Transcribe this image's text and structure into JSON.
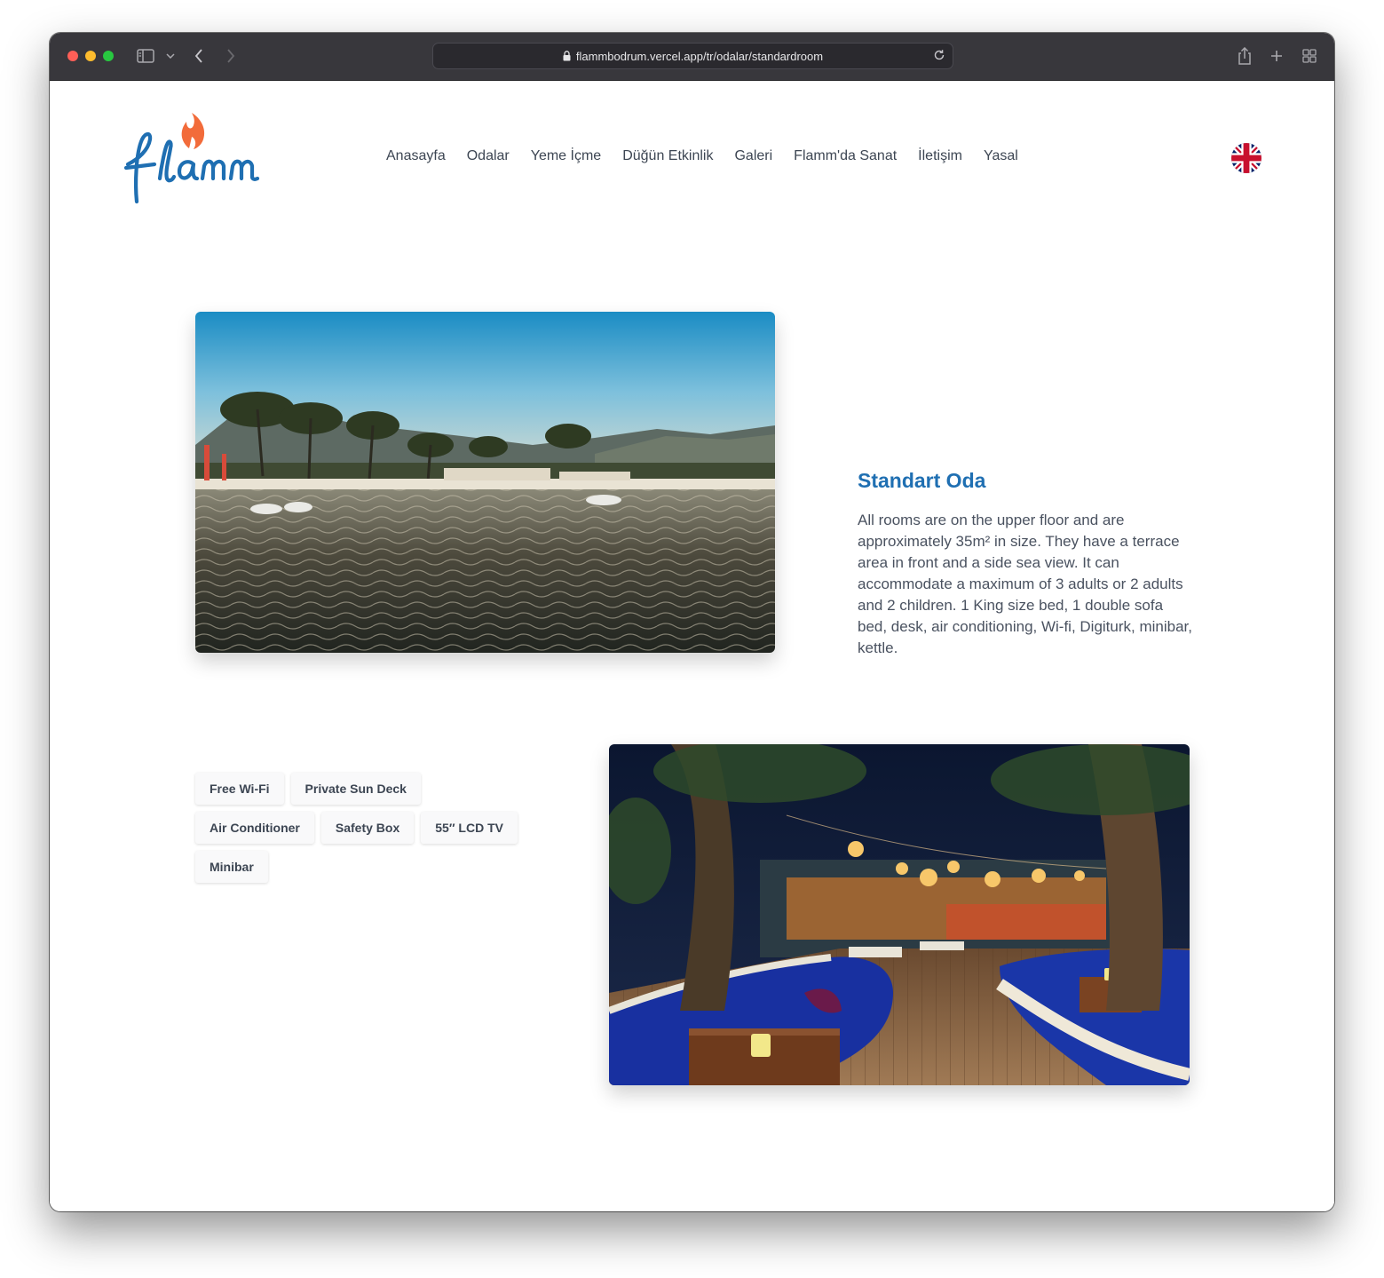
{
  "browser": {
    "url": "flammbodrum.vercel.app/tr/odalar/standardroom"
  },
  "site": {
    "logo_text": "flamm",
    "nav": [
      {
        "label": "Anasayfa"
      },
      {
        "label": "Odalar"
      },
      {
        "label": "Yeme İçme"
      },
      {
        "label": "Düğün Etkinlik"
      },
      {
        "label": "Galeri"
      },
      {
        "label": "Flamm'da Sanat"
      },
      {
        "label": "İletişim"
      },
      {
        "label": "Yasal"
      }
    ],
    "language_flag": "uk-flag-icon"
  },
  "room": {
    "title": "Standart Oda",
    "description": "All rooms are on the upper floor and are approximately 35m² in size. They have a terrace area in front and a side sea view. It can accommodate a maximum of 3 adults or 2 adults and 2 children. 1 King size bed, 1 double sofa bed, desk, air conditioning, Wi-fi, Digiturk, minibar, kettle.",
    "amenities": [
      {
        "label": "Free Wi-Fi"
      },
      {
        "label": "Private Sun Deck"
      },
      {
        "label": "Air Conditioner"
      },
      {
        "label": "Safety Box"
      },
      {
        "label": "55″ LCD TV"
      },
      {
        "label": "Minibar"
      }
    ]
  },
  "colors": {
    "accent_blue": "#1f6fb2",
    "logo_flame": "#f26b3a",
    "nav_text": "#3d4653"
  }
}
